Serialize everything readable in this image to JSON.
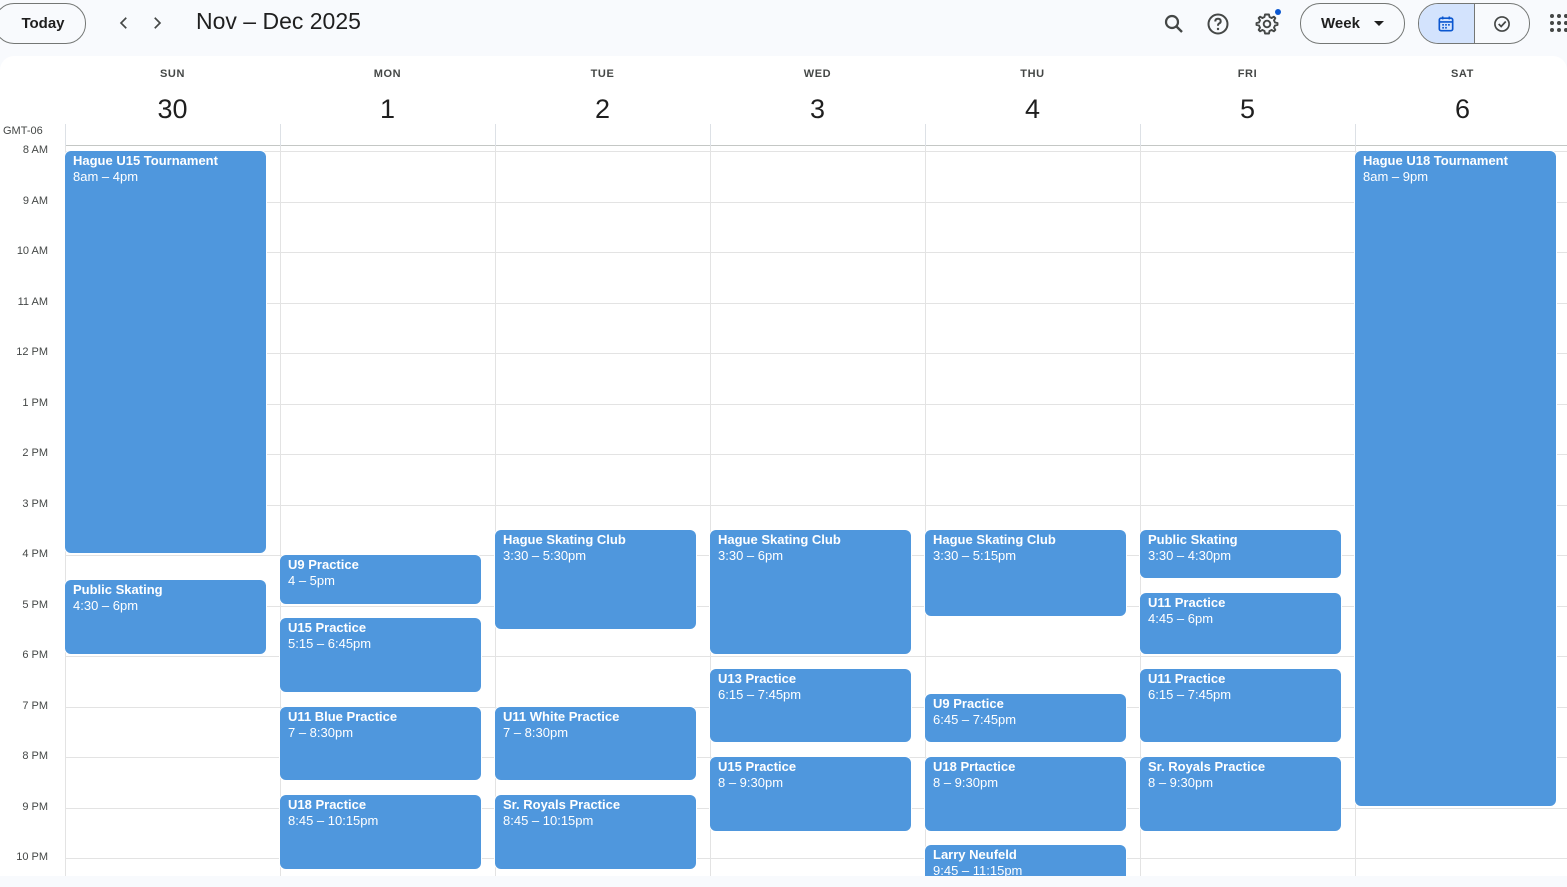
{
  "toolbar": {
    "today_label": "Today",
    "date_range": "Nov – Dec 2025",
    "view_label": "Week",
    "prev_icon": "chevron-left-icon",
    "next_icon": "chevron-right-icon",
    "search_icon": "search-icon",
    "help_icon": "help-icon",
    "settings_icon": "gear-icon",
    "calendar_icon": "calendar-icon",
    "tasks_icon": "check-circle-icon",
    "apps_icon": "apps-grid-icon",
    "accent_color": "#d3e3fd"
  },
  "timezone": "GMT-06",
  "days": [
    {
      "name": "SUN",
      "number": "30"
    },
    {
      "name": "MON",
      "number": "1"
    },
    {
      "name": "TUE",
      "number": "2"
    },
    {
      "name": "WED",
      "number": "3"
    },
    {
      "name": "THU",
      "number": "4"
    },
    {
      "name": "FRI",
      "number": "5"
    },
    {
      "name": "SAT",
      "number": "6"
    }
  ],
  "hours": [
    "8 AM",
    "9 AM",
    "10 AM",
    "11 AM",
    "12 PM",
    "1 PM",
    "2 PM",
    "3 PM",
    "4 PM",
    "5 PM",
    "6 PM",
    "7 PM",
    "8 PM",
    "9 PM",
    "10 PM"
  ],
  "event_color": "#4f97dd",
  "events": [
    {
      "day": 0,
      "start": 8.0,
      "end": 16.0,
      "title": "Hague U15 Tournament",
      "time": "8am – 4pm"
    },
    {
      "day": 0,
      "start": 16.5,
      "end": 18.0,
      "title": "Public Skating",
      "time": "4:30 – 6pm"
    },
    {
      "day": 1,
      "start": 16.0,
      "end": 17.0,
      "title": "U9 Practice",
      "time": "4 – 5pm"
    },
    {
      "day": 1,
      "start": 17.25,
      "end": 18.75,
      "title": "U15 Practice",
      "time": "5:15 – 6:45pm"
    },
    {
      "day": 1,
      "start": 19.0,
      "end": 20.5,
      "title": "U11 Blue Practice",
      "time": "7 – 8:30pm"
    },
    {
      "day": 1,
      "start": 20.75,
      "end": 22.25,
      "title": "U18 Practice",
      "time": "8:45 – 10:15pm"
    },
    {
      "day": 2,
      "start": 15.5,
      "end": 17.5,
      "title": "Hague Skating Club",
      "time": "3:30 – 5:30pm"
    },
    {
      "day": 2,
      "start": 19.0,
      "end": 20.5,
      "title": "U11 White Practice",
      "time": "7 – 8:30pm"
    },
    {
      "day": 2,
      "start": 20.75,
      "end": 22.25,
      "title": "Sr. Royals Practice",
      "time": "8:45 – 10:15pm"
    },
    {
      "day": 3,
      "start": 15.5,
      "end": 18.0,
      "title": "Hague Skating Club",
      "time": "3:30 – 6pm"
    },
    {
      "day": 3,
      "start": 18.25,
      "end": 19.75,
      "title": "U13 Practice",
      "time": "6:15 – 7:45pm"
    },
    {
      "day": 3,
      "start": 20.0,
      "end": 21.5,
      "title": "U15 Practice",
      "time": "8 – 9:30pm"
    },
    {
      "day": 4,
      "start": 15.5,
      "end": 17.25,
      "title": "Hague Skating Club",
      "time": "3:30 – 5:15pm"
    },
    {
      "day": 4,
      "start": 18.75,
      "end": 19.75,
      "title": "U9 Practice",
      "time": "6:45 – 7:45pm"
    },
    {
      "day": 4,
      "start": 20.0,
      "end": 21.5,
      "title": "U18 Prtactice",
      "time": "8 – 9:30pm"
    },
    {
      "day": 4,
      "start": 21.75,
      "end": 23.25,
      "title": "Larry Neufeld",
      "time": "9:45 – 11:15pm"
    },
    {
      "day": 5,
      "start": 15.5,
      "end": 16.5,
      "title": "Public Skating",
      "time": "3:30 – 4:30pm"
    },
    {
      "day": 5,
      "start": 16.75,
      "end": 18.0,
      "title": "U11 Practice",
      "time": "4:45 – 6pm"
    },
    {
      "day": 5,
      "start": 18.25,
      "end": 19.75,
      "title": "U11 Practice",
      "time": "6:15 – 7:45pm"
    },
    {
      "day": 5,
      "start": 20.0,
      "end": 21.5,
      "title": "Sr. Royals Practice",
      "time": "8 – 9:30pm"
    },
    {
      "day": 6,
      "start": 8.0,
      "end": 21.0,
      "title": "Hague U18 Tournament",
      "time": "8am – 9pm"
    }
  ]
}
